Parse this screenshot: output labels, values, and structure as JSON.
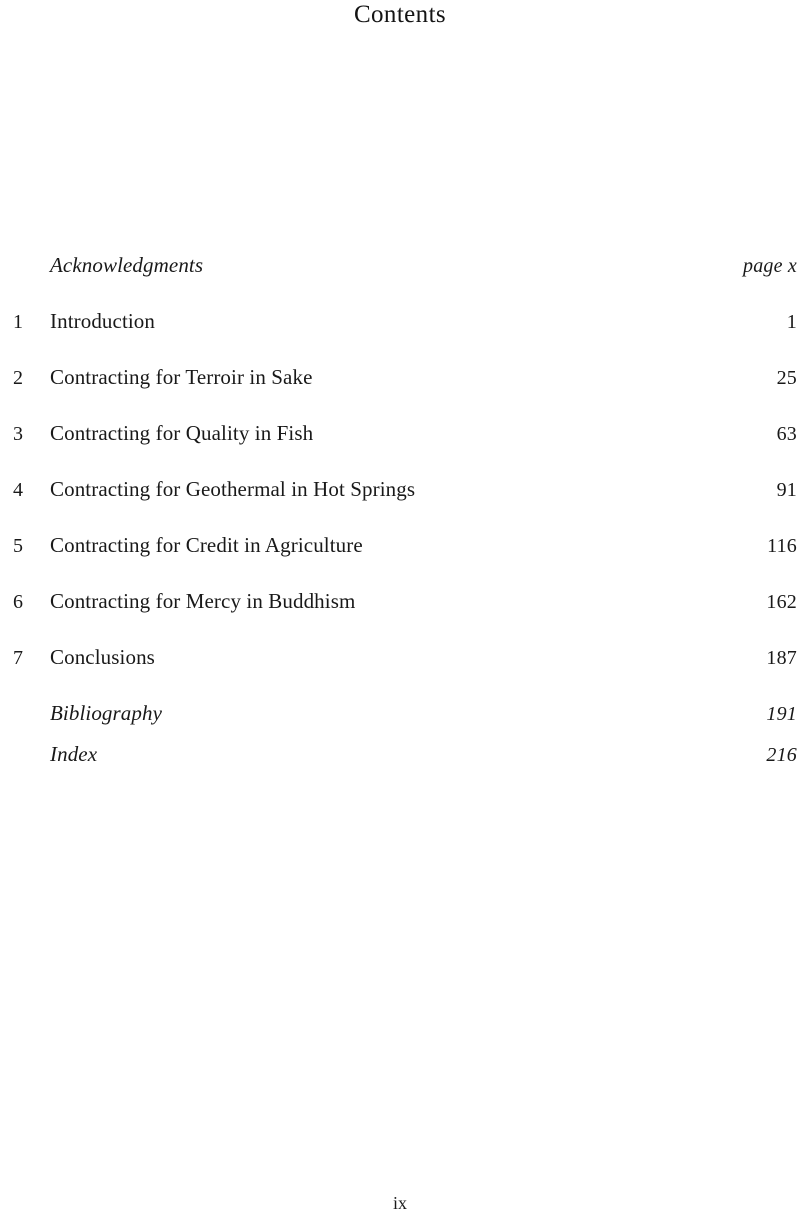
{
  "page": {
    "heading": "Contents",
    "folio": "ix"
  },
  "front_matter": [
    {
      "label": "Acknowledgments",
      "page": "page x"
    }
  ],
  "chapters": [
    {
      "num": "1",
      "label": "Introduction",
      "page": "1"
    },
    {
      "num": "2",
      "label": "Contracting for Terroir in Sake",
      "page": "25"
    },
    {
      "num": "3",
      "label": "Contracting for Quality in Fish",
      "page": "63"
    },
    {
      "num": "4",
      "label": "Contracting for Geothermal in Hot Springs",
      "page": "91"
    },
    {
      "num": "5",
      "label": "Contracting for Credit in Agriculture",
      "page": "116"
    },
    {
      "num": "6",
      "label": "Contracting for Mercy in Buddhism",
      "page": "162"
    },
    {
      "num": "7",
      "label": "Conclusions",
      "page": "187"
    }
  ],
  "back_matter": [
    {
      "label": "Bibliography",
      "page": "191"
    },
    {
      "label": "Index",
      "page": "216"
    }
  ]
}
